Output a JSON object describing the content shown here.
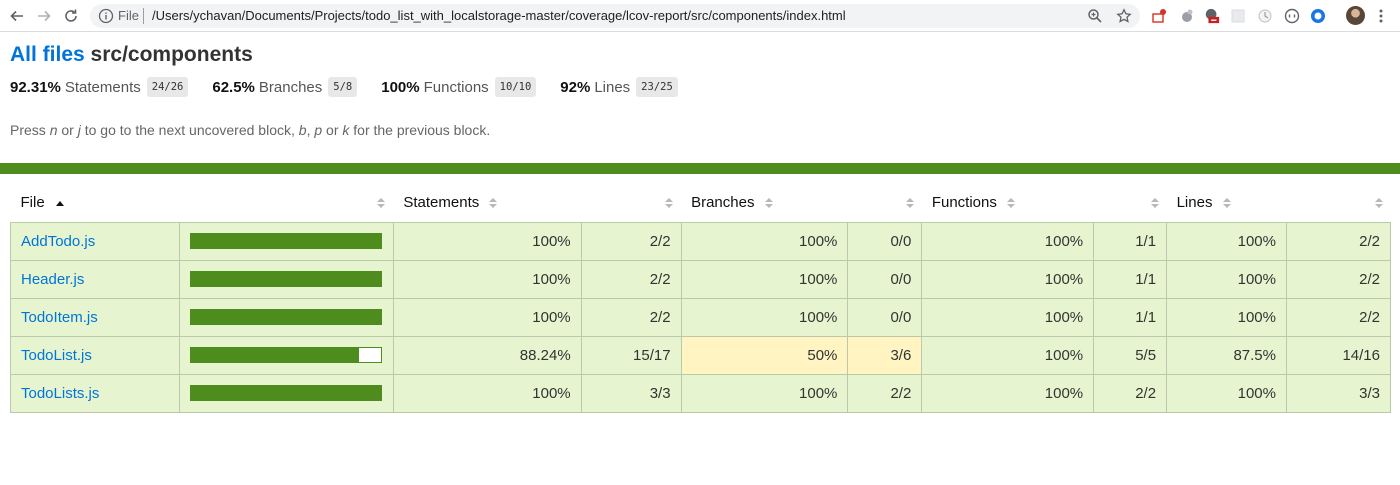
{
  "browser": {
    "file_label": "File",
    "url": "/Users/ychavan/Documents/Projects/todo_list_with_localstorage-master/coverage/lcov-report/src/components/index.html"
  },
  "header": {
    "all_files_link": "All files",
    "path": "src/components"
  },
  "summary": [
    {
      "pct": "92.31%",
      "label": "Statements",
      "fraction": "24/26"
    },
    {
      "pct": "62.5%",
      "label": "Branches",
      "fraction": "5/8"
    },
    {
      "pct": "100%",
      "label": "Functions",
      "fraction": "10/10"
    },
    {
      "pct": "92%",
      "label": "Lines",
      "fraction": "23/25"
    }
  ],
  "hint": {
    "press": "Press",
    "n": "n",
    "or1": "or",
    "j": "j",
    "mid": "to go to the next uncovered block,",
    "b": "b",
    "comma": ",",
    "p": "p",
    "or2": "or",
    "k": "k",
    "end": "for the previous block."
  },
  "table": {
    "headers": {
      "file": "File",
      "statements": "Statements",
      "branches": "Branches",
      "functions": "Functions",
      "lines": "Lines"
    },
    "rows": [
      {
        "file": "AddTodo.js",
        "bar_fraction": 1.0,
        "stmt_pct": "100%",
        "stmt": "2/2",
        "branch_pct": "100%",
        "branch": "0/0",
        "func_pct": "100%",
        "func": "1/1",
        "line_pct": "100%",
        "line": "2/2",
        "branch_level": "high"
      },
      {
        "file": "Header.js",
        "bar_fraction": 1.0,
        "stmt_pct": "100%",
        "stmt": "2/2",
        "branch_pct": "100%",
        "branch": "0/0",
        "func_pct": "100%",
        "func": "1/1",
        "line_pct": "100%",
        "line": "2/2",
        "branch_level": "high"
      },
      {
        "file": "TodoItem.js",
        "bar_fraction": 1.0,
        "stmt_pct": "100%",
        "stmt": "2/2",
        "branch_pct": "100%",
        "branch": "0/0",
        "func_pct": "100%",
        "func": "1/1",
        "line_pct": "100%",
        "line": "2/2",
        "branch_level": "high"
      },
      {
        "file": "TodoList.js",
        "bar_fraction": 0.8824,
        "stmt_pct": "88.24%",
        "stmt": "15/17",
        "branch_pct": "50%",
        "branch": "3/6",
        "func_pct": "100%",
        "func": "5/5",
        "line_pct": "87.5%",
        "line": "14/16",
        "branch_level": "medium"
      },
      {
        "file": "TodoLists.js",
        "bar_fraction": 1.0,
        "stmt_pct": "100%",
        "stmt": "3/3",
        "branch_pct": "100%",
        "branch": "2/2",
        "func_pct": "100%",
        "func": "2/2",
        "line_pct": "100%",
        "line": "3/3",
        "branch_level": "high"
      }
    ]
  },
  "colors": {
    "high_bg": "#e6f5d0",
    "medium_bg": "#fff4c2",
    "bar_green": "#4d8c1d",
    "link_blue": "#0074d9"
  },
  "icons": {
    "back": "back-arrow-icon",
    "forward": "forward-arrow-icon",
    "reload": "reload-icon",
    "info": "info-icon",
    "zoom": "zoom-icon",
    "star": "bookmark-star-icon",
    "sort": "sort-icon"
  }
}
